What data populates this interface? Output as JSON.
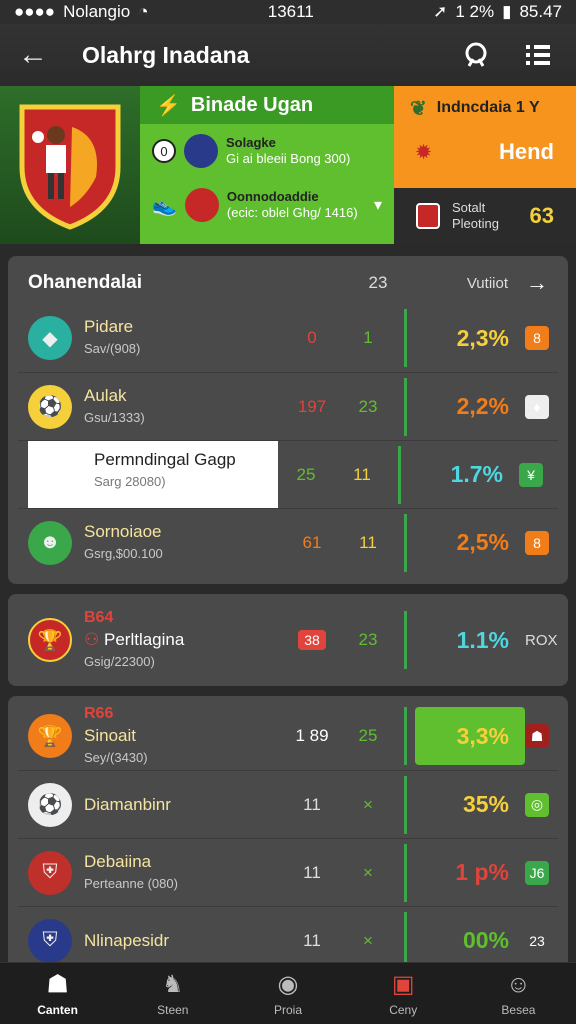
{
  "status": {
    "carrier": "Nolangio",
    "time_center": "13611",
    "battery": "1 2%",
    "time_right": "85.47"
  },
  "appbar": {
    "title": "Olahrg Inadana"
  },
  "banner": {
    "promo_title": "Binade Ugan",
    "row1_title": "Solagke",
    "row1_sub": "Gi ai bleeii Bong 300)",
    "row2_title": "Oonnodoaddie",
    "row2_sub": "(ecic: oblel Ghg/ 1416)",
    "side_top": "Indncdaia 1 Y",
    "side_mid": "Hend",
    "side_bot_label1": "Sotalt",
    "side_bot_label2": "Pleoting",
    "side_bot_value": "63"
  },
  "card1": {
    "title": "Ohanendalai",
    "count": "23",
    "link": "Vutiiot",
    "rows": [
      {
        "name": "Pidare",
        "sub": "Sav/(908)",
        "n1": "0",
        "n2": "1",
        "pct": "2,3%",
        "badge": "8",
        "n1_color": "#e0443a",
        "n2_color": "#5fbf2e",
        "pct_color": "#f5d03a",
        "badge_color": "#f07d1a",
        "avatar_color": "#2ab0a0",
        "avatar_icon": "◆"
      },
      {
        "name": "Aulak",
        "sub": "Gsu/1333)",
        "n1": "197",
        "n2": "23",
        "pct": "2,2%",
        "badge": "♦",
        "n1_color": "#e0443a",
        "n2_color": "#5fbf2e",
        "pct_color": "#f07d1a",
        "badge_color": "#eeeeee",
        "avatar_color": "#f5d03a",
        "avatar_icon": "⚽"
      },
      {
        "name": "Permndingal Gagp",
        "sub": "Sarg 28080)",
        "n1": "25",
        "n2": "11",
        "pct": "1.7%",
        "badge": "¥",
        "n1_color": "#5fbf2e",
        "n2_color": "#f5d03a",
        "pct_color": "#4fd6e0",
        "badge_color": "#3aa84a",
        "avatar_color": "#f07d1a",
        "avatar_icon": "☻"
      },
      {
        "name": "Sornoiaoe",
        "sub": "Gsrg,$00.100",
        "n1": "61",
        "n2": "11",
        "pct": "2,5%",
        "badge": "8",
        "n1_color": "#f07d1a",
        "n2_color": "#f5d03a",
        "pct_color": "#f07d1a",
        "badge_color": "#f07d1a",
        "avatar_color": "#3aa84a",
        "avatar_icon": "☻"
      }
    ]
  },
  "card2": {
    "tag": "B64",
    "name": "Perltlagina",
    "sub": "Gsig/22300)",
    "n1": "38",
    "n2": "23",
    "pct": "1.1%",
    "right": "ROX"
  },
  "card3": {
    "tag": "R66",
    "rows": [
      {
        "name": "Sinoait",
        "sub": "Sey/(3430)",
        "n1": "1 89",
        "n2": "25",
        "pct": "3,3%",
        "badge": "☗",
        "n1_color": "#ffffff",
        "n2_color": "#5fbf2e",
        "pct_color": "#f5d03a",
        "badge_color": "#a0201c",
        "avatar_color": "#f07d1a",
        "avatar_icon": "🏆"
      },
      {
        "name": "Diamanbinr",
        "sub": "",
        "n1": "11",
        "n2": "×",
        "pct": "35%",
        "badge": "◎",
        "n1_color": "#dddddd",
        "n2_color": "#5fbf2e",
        "pct_color": "#f5d03a",
        "badge_color": "#5fbf2e",
        "avatar_color": "#eeeeee",
        "avatar_icon": "⚽"
      },
      {
        "name": "Debaiina",
        "sub": "Perteanne (080)",
        "n1": "11",
        "n2": "×",
        "pct": "1 p%",
        "badge": "J6",
        "n1_color": "#dddddd",
        "n2_color": "#5fbf2e",
        "pct_color": "#e0443a",
        "badge_color": "#3aa84a",
        "avatar_color": "#c0302a",
        "avatar_icon": "⛨"
      },
      {
        "name": "Nlinapesidr",
        "sub": "",
        "n1": "11",
        "n2": "×",
        "pct": "00%",
        "badge": "23",
        "n1_color": "#dddddd",
        "n2_color": "#5fbf2e",
        "pct_color": "#5fbf2e",
        "badge_color": "transparent",
        "avatar_color": "#2a3a8a",
        "avatar_icon": "⛨"
      }
    ]
  },
  "tabs": [
    {
      "label": "Canten",
      "icon": "home-icon"
    },
    {
      "label": "Steen",
      "icon": "bird-icon"
    },
    {
      "label": "Proia",
      "icon": "compass-icon"
    },
    {
      "label": "Ceny",
      "icon": "ticket-icon"
    },
    {
      "label": "Besea",
      "icon": "user-icon"
    }
  ]
}
